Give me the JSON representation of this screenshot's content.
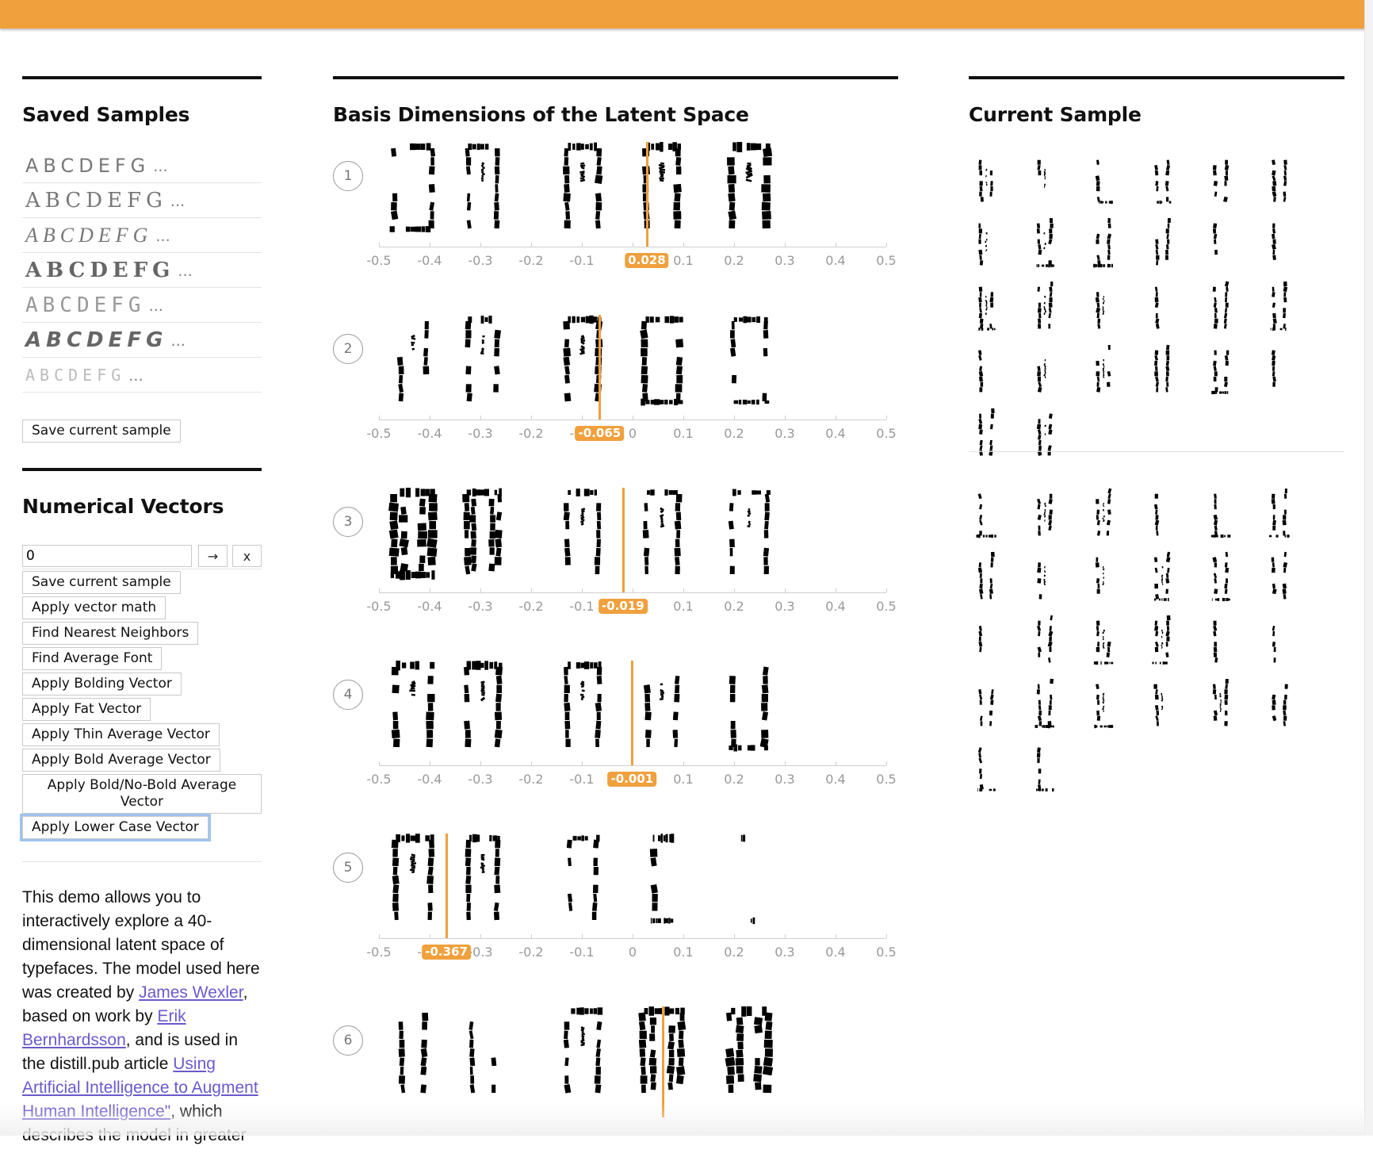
{
  "left": {
    "saved_title": "Saved Samples",
    "samples": [
      {
        "glyphs": "ABCDEFG",
        "ellipsis": "..."
      },
      {
        "glyphs": "ABCDEFG",
        "ellipsis": "..."
      },
      {
        "glyphs": "ABCDEFG",
        "ellipsis": "..."
      },
      {
        "glyphs": "ABCDEFG",
        "ellipsis": "..."
      },
      {
        "glyphs": "ABCDEFG",
        "ellipsis": "..."
      },
      {
        "glyphs": "ABCDEFG",
        "ellipsis": "..."
      },
      {
        "glyphs": "ABCDEFG",
        "ellipsis": "..."
      }
    ],
    "save_button": "Save current sample",
    "vectors_title": "Numerical Vectors",
    "vector_input_value": "0",
    "go_button": "→",
    "clear_button": "x",
    "buttons": [
      "Save current sample",
      "Apply vector math",
      "Find Nearest Neighbors",
      "Find Average Font",
      "Apply Bolding Vector",
      "Apply Fat Vector",
      "Apply Thin Average Vector",
      "Apply Bold Average Vector",
      "Apply Bold/No-Bold Average Vector",
      "Apply Lower Case Vector"
    ],
    "description": {
      "p1": "This demo allows you to interactively explore a 40-dimensional latent space of typefaces. The model used here was created by ",
      "link1": "James Wexler",
      "p2": ", based on work by ",
      "link2": "Erik Bernhardsson",
      "p3": ", and is used in the distill.pub article ",
      "link3": "Using Artificial Intelligence to Augment Human Intelligence\"",
      "p4": ", which describes the model in greater"
    }
  },
  "middle": {
    "title": "Basis Dimensions of the Latent Space",
    "tick_labels": [
      "-0.5",
      "-0.4",
      "-0.3",
      "-0.2",
      "-0.1",
      "0",
      "0.1",
      "0.2",
      "0.3",
      "0.4",
      "0.5"
    ],
    "dimensions": [
      {
        "index": "1",
        "value": 0.028,
        "value_label": "0.028"
      },
      {
        "index": "2",
        "value": -0.065,
        "value_label": "-0.065"
      },
      {
        "index": "3",
        "value": -0.019,
        "value_label": "-0.019"
      },
      {
        "index": "4",
        "value": -0.001,
        "value_label": "-0.001"
      },
      {
        "index": "5",
        "value": -0.367,
        "value_label": "-0.367"
      },
      {
        "index": "6",
        "value": 0.06,
        "value_label": ""
      }
    ]
  },
  "right": {
    "title": "Current Sample",
    "letters": [
      "A",
      "B",
      "C",
      "D",
      "E",
      "F",
      "G",
      "H",
      "I",
      "J",
      "K",
      "L",
      "M",
      "N",
      "O",
      "P",
      "Q",
      "R",
      "S",
      "T",
      "U",
      "V",
      "W",
      "X",
      "Y",
      "Z"
    ]
  },
  "colors": {
    "accent": "#f0a03c",
    "link": "#6a5acd"
  }
}
